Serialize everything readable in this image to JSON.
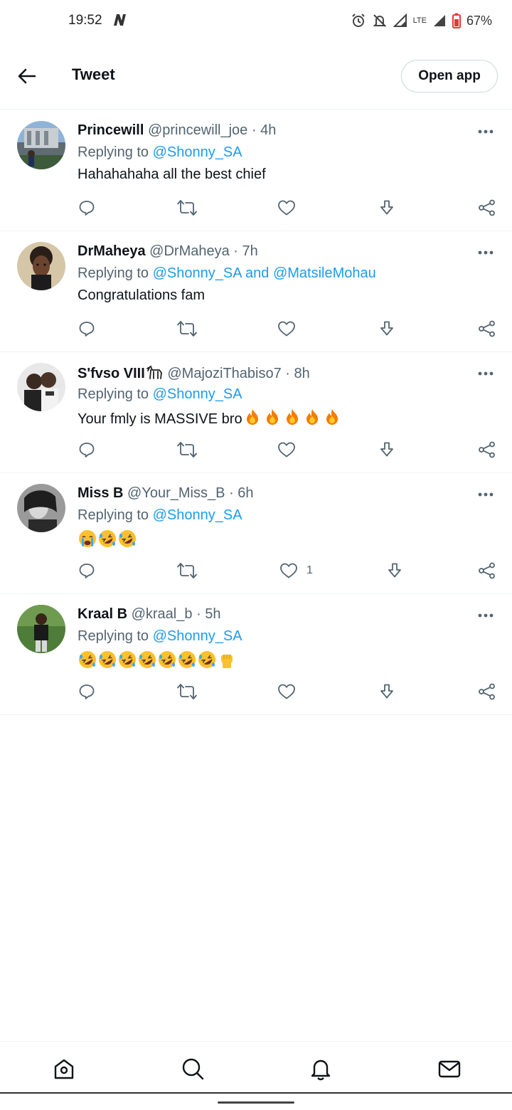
{
  "status": {
    "time": "19:52",
    "network": "LTE",
    "battery": "67%"
  },
  "header": {
    "title": "Tweet",
    "open_app_label": "Open app"
  },
  "labels": {
    "replying_to": "Replying to",
    "and": "and",
    "dot": "·"
  },
  "tweets": [
    {
      "name": "Princewill",
      "handle": "@princewill_joe",
      "time": "4h",
      "mention1": "@Shonny_SA",
      "text": "Hahahahaha all the best chief",
      "like_count": ""
    },
    {
      "name": "DrMaheya",
      "handle": "@DrMaheya",
      "time": "7h",
      "mention1": "@Shonny_SA",
      "mention2": "@MatsileMohau",
      "text": "Congratulations fam",
      "like_count": ""
    },
    {
      "name": "S'fvso VIII",
      "handle": "@MajoziThabiso7",
      "time": "8h",
      "mention1": "@Shonny_SA",
      "text": "Your fmly is MASSIVE bro",
      "emojis": [
        "fire",
        "fire",
        "fire",
        "fire",
        "fire"
      ],
      "like_count": ""
    },
    {
      "name": "Miss B",
      "handle": "@Your_Miss_B",
      "time": "6h",
      "mention1": "@Shonny_SA",
      "text": "",
      "emojis": [
        "loudly-crying-face",
        "rolling-on-floor-laughing",
        "rolling-on-floor-laughing"
      ],
      "like_count": "1"
    },
    {
      "name": "Kraal B",
      "handle": "@kraal_b",
      "time": "5h",
      "mention1": "@Shonny_SA",
      "text": "",
      "emojis": [
        "rolling-on-floor-laughing",
        "rolling-on-floor-laughing",
        "rolling-on-floor-laughing",
        "rolling-on-floor-laughing",
        "rolling-on-floor-laughing",
        "rolling-on-floor-laughing",
        "rolling-on-floor-laughing",
        "raised-fist"
      ],
      "like_count": ""
    }
  ],
  "bottom_nav": [
    "home-icon",
    "search-icon",
    "notifications-icon",
    "messages-icon"
  ],
  "colors": {
    "accent": "#1d9bf0",
    "text_primary": "#0f1419",
    "text_secondary": "#536471",
    "divider": "#eff3f4"
  }
}
